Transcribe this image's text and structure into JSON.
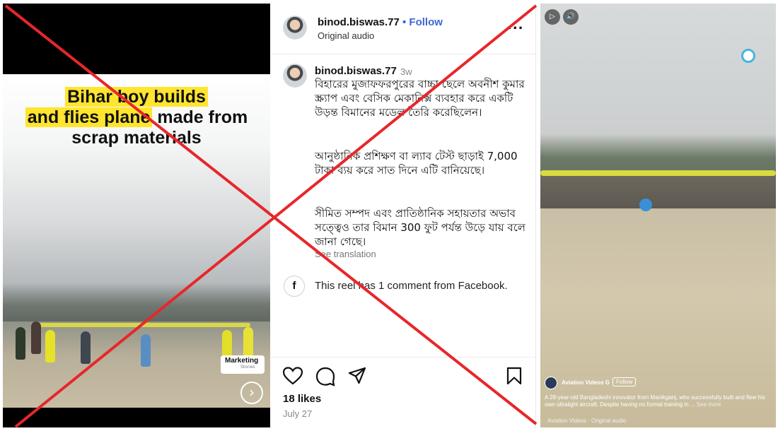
{
  "left_reel": {
    "caption_line1": "Bihar boy builds",
    "caption_line2_hl": "and flies plane",
    "caption_line2_rest": " made from",
    "caption_line3": "scrap materials",
    "badge_brand": "Marketing",
    "badge_sub": "Stones",
    "next_icon": "arrow-right-icon"
  },
  "post": {
    "username": "binod.biswas.77",
    "follow_label": "• Follow",
    "audio": "Original audio",
    "more_icon": "...",
    "comment_username": "binod.biswas.77",
    "comment_time": "3w",
    "paragraphs": [
      "বিহারের মুজাফফরপুরের বাচ্চা ছেলে অবনীশ কুমার  স্ক্র্যাপ এবং বেসিক মেকানিক্স ব্যবহার করে একটি উড়ন্ত বিমানের মডেল তৈরি করেছিলেন।",
      " আনুষ্ঠানিক প্রশিক্ষণ বা ল্যাব টেস্ট ছাড়াই 7,000 টাকা ব্যয় করে সাত দিনে এটি বানিয়েছে।",
      "সীমিত সম্পদ এবং প্রাতিষ্ঠানিক সহায়তার অভাব সত্ত্বেও তার বিমান 300 ফুট পর্যন্ত উড়ে যায় বলে জানা গেছে।"
    ],
    "see_translation": "See translation",
    "fb_glyph": "f",
    "fb_note": "This reel has 1 comment from Facebook.",
    "likes": "18 likes",
    "date": "July 27"
  },
  "right_reel": {
    "play_glyph": "▷",
    "sound_glyph": "🔊",
    "channel": "Aviation Videos G",
    "follow_label": "Follow",
    "description": "A 28-year-old Bangladeshi innovator from Manikganj, who successfully built and flew his own ultralight aircraft. Despite having no formal training in ...",
    "see_more": "See more",
    "audio_line": "Aviation Videos · Original audio"
  },
  "colors": {
    "highlight": "#ffe52e",
    "follow_blue": "#3b66d6",
    "cross_red": "#e8262a",
    "wing_yellow": "#d9da3e"
  }
}
